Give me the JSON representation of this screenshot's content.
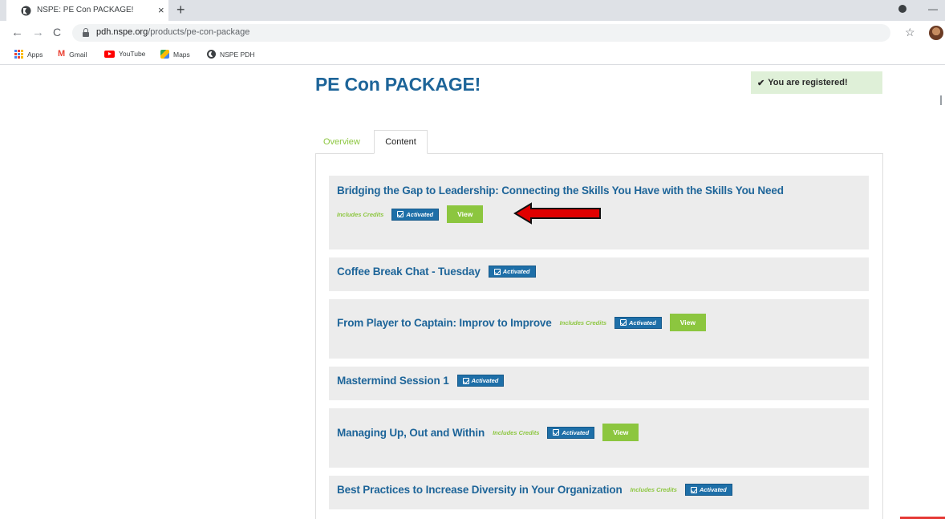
{
  "browser": {
    "tab_title": "NSPE: PE Con PACKAGE!",
    "url_host": "pdh.nspe.org",
    "url_path": "/products/pe-con-package",
    "bookmarks": [
      {
        "label": "Apps",
        "icon": "apps-grid-icon"
      },
      {
        "label": "Gmail",
        "icon": "gmail-icon"
      },
      {
        "label": "YouTube",
        "icon": "youtube-icon"
      },
      {
        "label": "Maps",
        "icon": "maps-icon"
      },
      {
        "label": "NSPE PDH",
        "icon": "globe-icon"
      }
    ]
  },
  "page": {
    "title": "PE Con PACKAGE!",
    "registered_text": "You are registered!",
    "tabs": [
      {
        "label": "Overview",
        "active": false
      },
      {
        "label": "Content",
        "active": true
      }
    ]
  },
  "labels": {
    "credits": "Includes Credits",
    "activated": "Activated",
    "view": "View"
  },
  "items": [
    {
      "title": "Bridging the Gap to Leadership: Connecting the Skills You Have with the Skills You Need",
      "credits": true,
      "view": true
    },
    {
      "title": "Coffee Break Chat - Tuesday",
      "credits": false,
      "view": false
    },
    {
      "title": "From Player to Captain: Improv to Improve",
      "credits": true,
      "view": true
    },
    {
      "title": "Mastermind Session 1",
      "credits": false,
      "view": false
    },
    {
      "title": "Managing Up, Out and Within",
      "credits": true,
      "view": true
    },
    {
      "title": "Best Practices to Increase Diversity in Your Organization",
      "credits": true,
      "view": false
    }
  ],
  "colors": {
    "title_blue": "#1e6599",
    "credits_green": "#8cc63f",
    "activated_blue": "#1e6fa8",
    "view_green": "#8cc63f",
    "registered_bg": "#dff0d8",
    "annotation_arrow": "#e00000"
  }
}
